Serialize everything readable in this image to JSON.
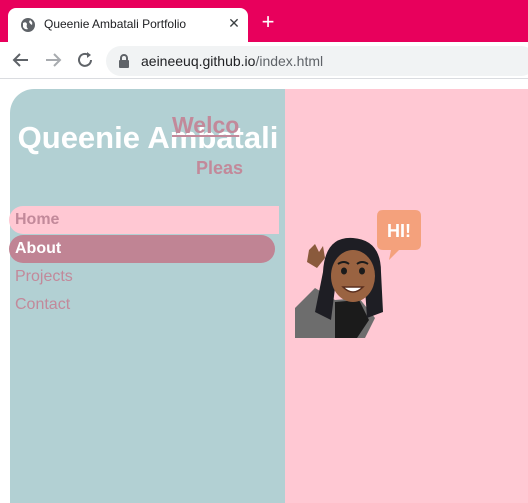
{
  "browser": {
    "tab_title": "Queenie Ambatali Portfolio",
    "tab_close_glyph": "✕",
    "new_tab_glyph": "+",
    "url_host": "aeineeuq.github.io",
    "url_path": "/index.html",
    "accent_color": "#e8005c"
  },
  "icons": {
    "favicon": "globe-icon",
    "back": "back-arrow-icon",
    "forward": "forward-arrow-icon",
    "reload": "reload-icon",
    "lock": "lock-icon"
  },
  "sidebar": {
    "title": "Queenie Ambatali",
    "bg_color": "#b2d0d3",
    "items": [
      {
        "label": "Home",
        "state": "current"
      },
      {
        "label": "About",
        "state": "hover"
      },
      {
        "label": "Projects",
        "state": "normal"
      },
      {
        "label": "Contact",
        "state": "normal"
      }
    ]
  },
  "main": {
    "heading": "Welco",
    "subheading": "Pleas",
    "bg_color": "#ffc8d3",
    "bitmoji_bubble_text": "HI!"
  }
}
